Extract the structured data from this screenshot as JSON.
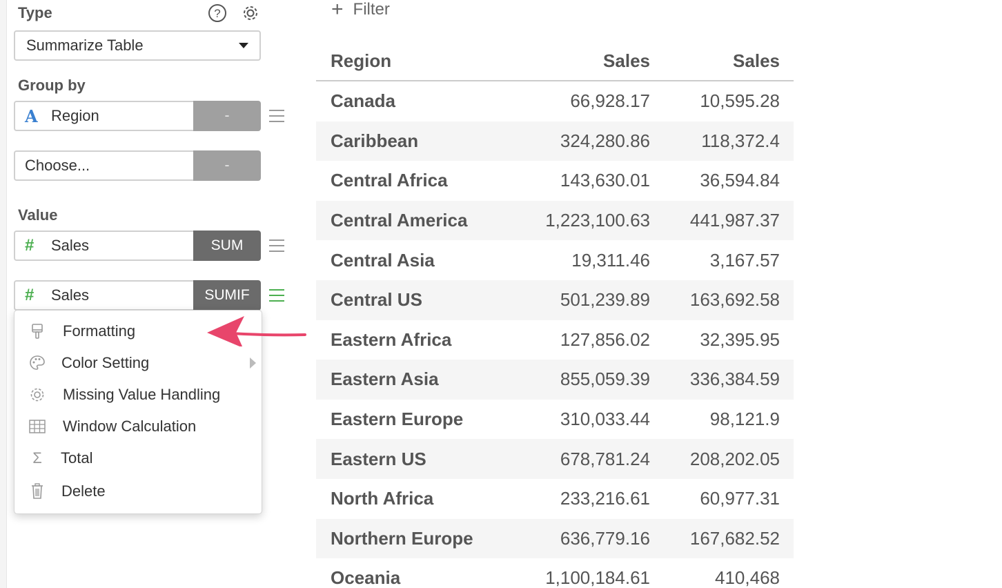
{
  "panel": {
    "type_label": "Type",
    "type_value": "Summarize Table",
    "group_by_label": "Group by",
    "group_by": [
      {
        "type_icon": "A",
        "name": "Region",
        "button": "-"
      },
      {
        "type_icon": "",
        "name": "Choose...",
        "button": "-"
      }
    ],
    "value_label": "Value",
    "values": [
      {
        "type_icon": "#",
        "name": "Sales",
        "agg": "SUM"
      },
      {
        "type_icon": "#",
        "name": "Sales",
        "agg": "SUMIF"
      }
    ]
  },
  "context_menu": {
    "items": [
      {
        "icon": "paint-brush-icon",
        "label": "Formatting"
      },
      {
        "icon": "palette-icon",
        "label": "Color Setting"
      },
      {
        "icon": "gear-icon",
        "label": "Missing Value Handling"
      },
      {
        "icon": "table-grid-icon",
        "label": "Window Calculation"
      },
      {
        "icon": "sigma-icon",
        "label": "Total"
      },
      {
        "icon": "trash-icon",
        "label": "Delete"
      }
    ]
  },
  "filter": {
    "label": "Filter"
  },
  "table": {
    "headers": [
      "Region",
      "Sales",
      "Sales"
    ],
    "rows": [
      [
        "Canada",
        "66,928.17",
        "10,595.28"
      ],
      [
        "Caribbean",
        "324,280.86",
        "118,372.4"
      ],
      [
        "Central Africa",
        "143,630.01",
        "36,594.84"
      ],
      [
        "Central America",
        "1,223,100.63",
        "441,987.37"
      ],
      [
        "Central Asia",
        "19,311.46",
        "3,167.57"
      ],
      [
        "Central US",
        "501,239.89",
        "163,692.58"
      ],
      [
        "Eastern Africa",
        "127,856.02",
        "32,395.95"
      ],
      [
        "Eastern Asia",
        "855,059.39",
        "336,384.59"
      ],
      [
        "Eastern Europe",
        "310,033.44",
        "98,121.9"
      ],
      [
        "Eastern US",
        "678,781.24",
        "208,202.05"
      ],
      [
        "North Africa",
        "233,216.61",
        "60,977.31"
      ],
      [
        "Northern Europe",
        "636,779.16",
        "167,682.52"
      ],
      [
        "Oceania",
        "1,100,184.61",
        "410,468"
      ]
    ]
  },
  "colors": {
    "accent_green": "#4caf50",
    "accent_blue": "#3a80d0",
    "annotation_pink": "#e8456b"
  }
}
